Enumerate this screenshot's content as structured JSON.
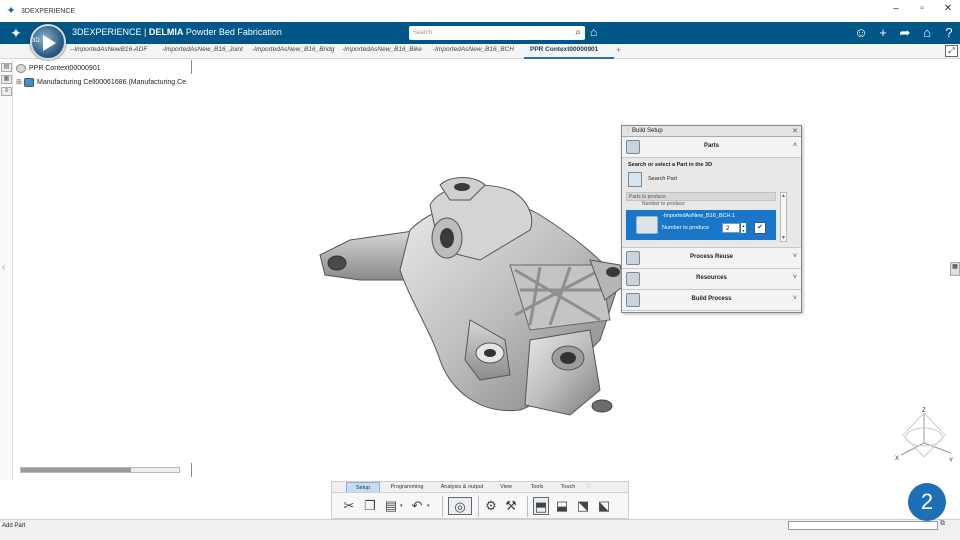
{
  "os_window": {
    "title": "3DEXPERIENCE",
    "buttons": [
      "–",
      "▫",
      "✕"
    ]
  },
  "header": {
    "brand_prefix": "3DEXPERIENCE | ",
    "brand_bold": "DELMIA",
    "brand_suffix": " Powder Bed Fabrication",
    "search_placeholder": "Search",
    "accent": "#005686"
  },
  "tabs": [
    {
      "label": "--ImportedAsNewB16-ADF",
      "active": false
    },
    {
      "label": "-ImportedAsNew_B16_Joint",
      "active": false
    },
    {
      "label": "-ImportedAsNew_B16_Bridg",
      "active": false
    },
    {
      "label": "-ImportedAsNew_B16_Bike",
      "active": false
    },
    {
      "label": "-ImportedAsNew_B16_BCH",
      "active": false
    },
    {
      "label": "PPR Context00000901",
      "active": true
    }
  ],
  "tree": {
    "root": "PPR Context00000901",
    "child": "Manufacturing Cell00061686 (Manufacturing Ce"
  },
  "build_setup": {
    "title": "Build Setup",
    "parts": {
      "header": "Parts",
      "prompt": "Search or select a Part in the 3D",
      "search_label": "Search Part",
      "list_label": "Parts to produce",
      "ghost_label": "Number to produce",
      "row": {
        "name": "-ImportedAsNew_B16_BCH.1",
        "number_label": "Number to produce",
        "quantity": "2"
      }
    },
    "sections": [
      {
        "label": "Process Reuse"
      },
      {
        "label": "Resources"
      },
      {
        "label": "Build Process"
      }
    ]
  },
  "action_bar": {
    "tabs": [
      {
        "label": "Setup",
        "active": true
      },
      {
        "label": "Programming",
        "active": false
      },
      {
        "label": "Analysis & output",
        "active": false
      },
      {
        "label": "View",
        "active": false
      },
      {
        "label": "Tools",
        "active": false
      },
      {
        "label": "Touch",
        "active": false
      }
    ]
  },
  "status_bar": {
    "text": "Add Part"
  },
  "axis": {
    "x": "X",
    "y": "Y",
    "z": "Z"
  },
  "step_badge": "2"
}
